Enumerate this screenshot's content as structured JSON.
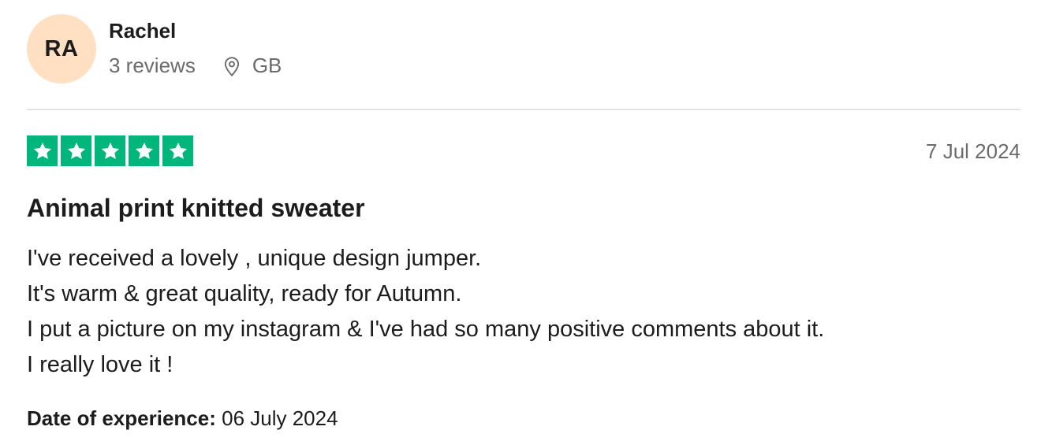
{
  "consumer": {
    "initials": "RA",
    "name": "Rachel",
    "review_count": "3 reviews",
    "country": "GB",
    "avatar_color": "#ffe0c2"
  },
  "review": {
    "rating": 5,
    "star_color": "#00b67a",
    "date": "7 Jul 2024",
    "title": "Animal print knitted sweater",
    "body_lines": [
      "I've received a lovely , unique design jumper.",
      "It's warm & great quality, ready for Autumn.",
      "I put a picture on my instagram & I've had so many positive comments about it.",
      "I really love it !"
    ],
    "experience_label": "Date of experience:",
    "experience_date": "06 July 2024"
  },
  "icons": {
    "location": "location-pin-icon",
    "star": "star-icon"
  }
}
